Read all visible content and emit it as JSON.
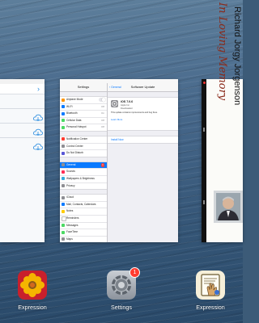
{
  "left_card": {
    "icons": [
      "chevron-right-icon",
      "cloud-download-icon",
      "cloud-download-icon",
      "cloud-download-icon"
    ]
  },
  "settings_card": {
    "master_title": "Settings",
    "groups": [
      [
        {
          "label": "Airplane Mode",
          "color": "#ff9500",
          "toggle": true
        },
        {
          "label": "Wi-Fi",
          "color": "#0a7aff",
          "value": "Off"
        },
        {
          "label": "Bluetooth",
          "color": "#0a7aff",
          "value": "On"
        },
        {
          "label": "Cellular Data",
          "color": "#4cd964",
          "value": "Off"
        },
        {
          "label": "Personal Hotspot",
          "color": "#4cd964",
          "value": "Off"
        }
      ],
      [
        {
          "label": "Notification Center",
          "color": "#ff3b30"
        },
        {
          "label": "Control Center",
          "color": "#8e8e93"
        },
        {
          "label": "Do Not Disturb",
          "color": "#5856d6"
        }
      ],
      [
        {
          "label": "General",
          "color": "#8e8e93",
          "active": true,
          "badge": "1"
        },
        {
          "label": "Sounds",
          "color": "#ff2d55"
        },
        {
          "label": "Wallpapers & Brightness",
          "color": "#34aadc"
        },
        {
          "label": "Privacy",
          "color": "#8e8e93"
        }
      ],
      [
        {
          "label": "iCloud",
          "color": "#8e8e93"
        },
        {
          "label": "Mail, Contacts, Calendars",
          "color": "#0a7aff"
        },
        {
          "label": "Notes",
          "color": "#ffcc00"
        },
        {
          "label": "Reminders",
          "color": "#ffffff"
        },
        {
          "label": "Messages",
          "color": "#4cd964"
        },
        {
          "label": "FaceTime",
          "color": "#4cd964"
        },
        {
          "label": "Maps",
          "color": "#8e8e93"
        }
      ]
    ],
    "detail": {
      "back_label": "General",
      "title": "Software Update",
      "update_name": "iOS 7.0.6",
      "update_vendor": "Apple Inc.",
      "update_state": "Downloaded",
      "update_desc": "This update contains improvements and bug fixes.",
      "learn_more": "Learn More",
      "install_now": "Install Now"
    }
  },
  "right_card": {
    "memory_text": "In Loving Memory",
    "name_text": "Richard Jorgy Jorgenson"
  },
  "dock": [
    {
      "label": "Expression",
      "icon": "flower-app-icon"
    },
    {
      "label": "Settings",
      "icon": "gear-app-icon",
      "badge": "1"
    },
    {
      "label": "Expression",
      "icon": "hand-card-app-icon"
    }
  ]
}
